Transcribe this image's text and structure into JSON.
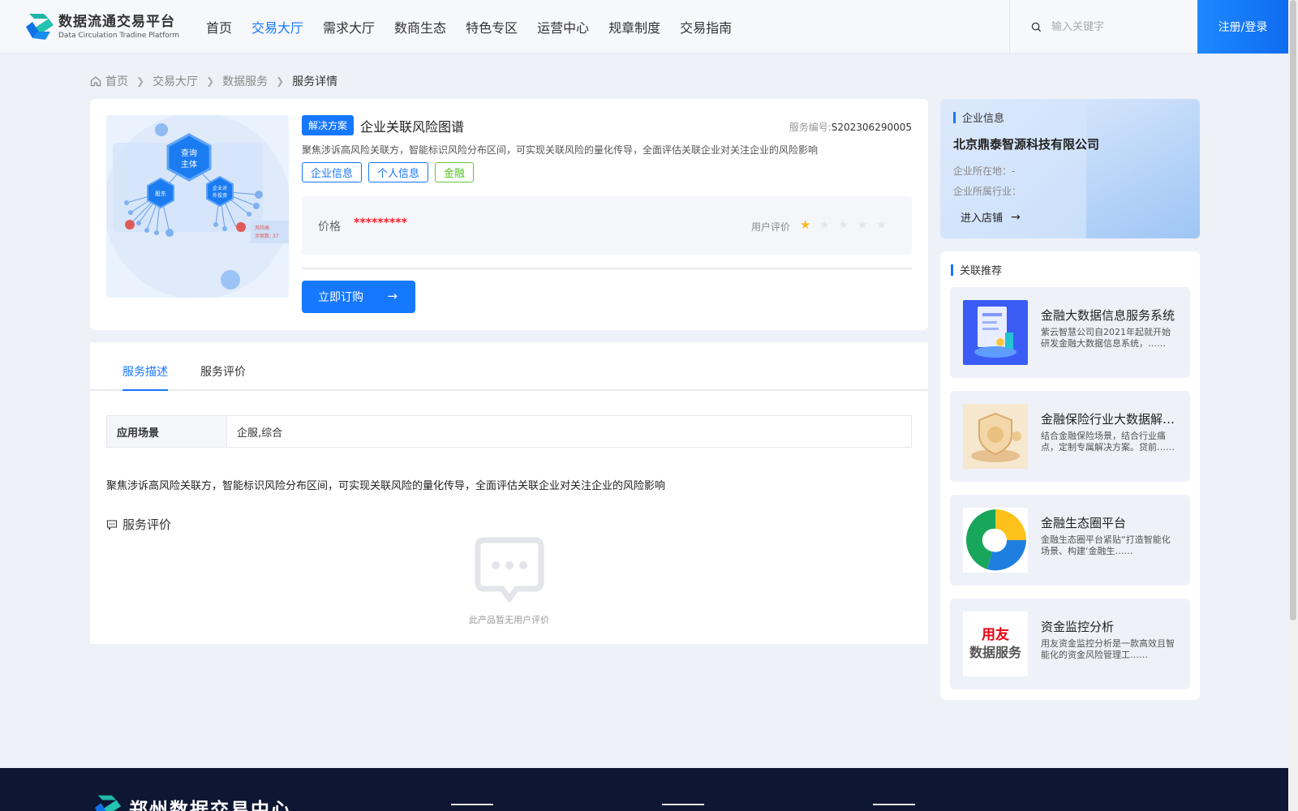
{
  "header": {
    "logo_cn": "数据流通交易平台",
    "logo_en": "Data Circulation Tradine Platform",
    "nav": [
      "首页",
      "交易大厅",
      "需求大厅",
      "数商生态",
      "特色专区",
      "运营中心",
      "规章制度",
      "交易指南"
    ],
    "active_nav": "交易大厅",
    "search_placeholder": "输入关键字",
    "login_label": "注册/登录"
  },
  "breadcrumb": [
    "首页",
    "交易大厅",
    "数据服务",
    "服务详情"
  ],
  "product": {
    "badge": "解决方案",
    "title": "企业关联风险图谱",
    "service_no_label": "服务编号:",
    "service_no": "S202306290005",
    "desc": "聚焦涉诉高风险关联方，智能标识风险分布区间，可实现关联风险的量化传导，全面评估关联企业对关注企业的风险影响",
    "tags": [
      "企业信息",
      "个人信息",
      "金融"
    ],
    "price_label": "价格",
    "price_value": "*********",
    "rating_label": "用户评价",
    "rating": 1,
    "rating_max": 5,
    "buy_label": "立即订购",
    "image_texts": {
      "center": "查询\n主体",
      "left": "股东",
      "right": "企业对\n外投资",
      "risk": "风险高\n涉案数: 37"
    }
  },
  "tabs": [
    "服务描述",
    "服务评价"
  ],
  "active_tab": "服务描述",
  "scene": {
    "label": "应用场景",
    "value": "企服,综合"
  },
  "description_full": "聚焦涉诉高风险关联方，智能标识风险分布区间，可实现关联风险的量化传导，全面评估关联企业对关注企业的风险影响",
  "review": {
    "title": "服务评价",
    "empty_text": "此产品暂无用户评价"
  },
  "company": {
    "section_title": "企业信息",
    "name": "北京鼎泰智源科技有限公司",
    "location": "企业所在地：-",
    "industry": "企业所属行业：",
    "enter_label": "进入店铺"
  },
  "recommend": {
    "section_title": "关联推荐",
    "items": [
      {
        "title": "金融大数据信息服务系统",
        "desc": "紫云智慧公司自2021年起就开始研发金融大数据信息系统，……"
      },
      {
        "title": "金融保险行业大数据解决方案",
        "desc": "结合金融保险场景，结合行业痛点，定制专属解决方案。贷前……"
      },
      {
        "title": "金融生态圈平台",
        "desc": "金融生态圈平台紧贴“打造智能化场景、构建‘金融生……"
      },
      {
        "title": "资金监控分析",
        "desc": "用友资金监控分析是一款高效且智能化的资金风险管理工……",
        "logo_line1": "用友",
        "logo_line2": "数据服务"
      }
    ]
  },
  "footer": {
    "title": "郑州数据交易中心"
  },
  "colors": {
    "primary": "#1677ff",
    "price": "#f5222d",
    "star": "#f5b81c",
    "tag_green": "#52c41a",
    "footer_bg": "#0d1633"
  }
}
